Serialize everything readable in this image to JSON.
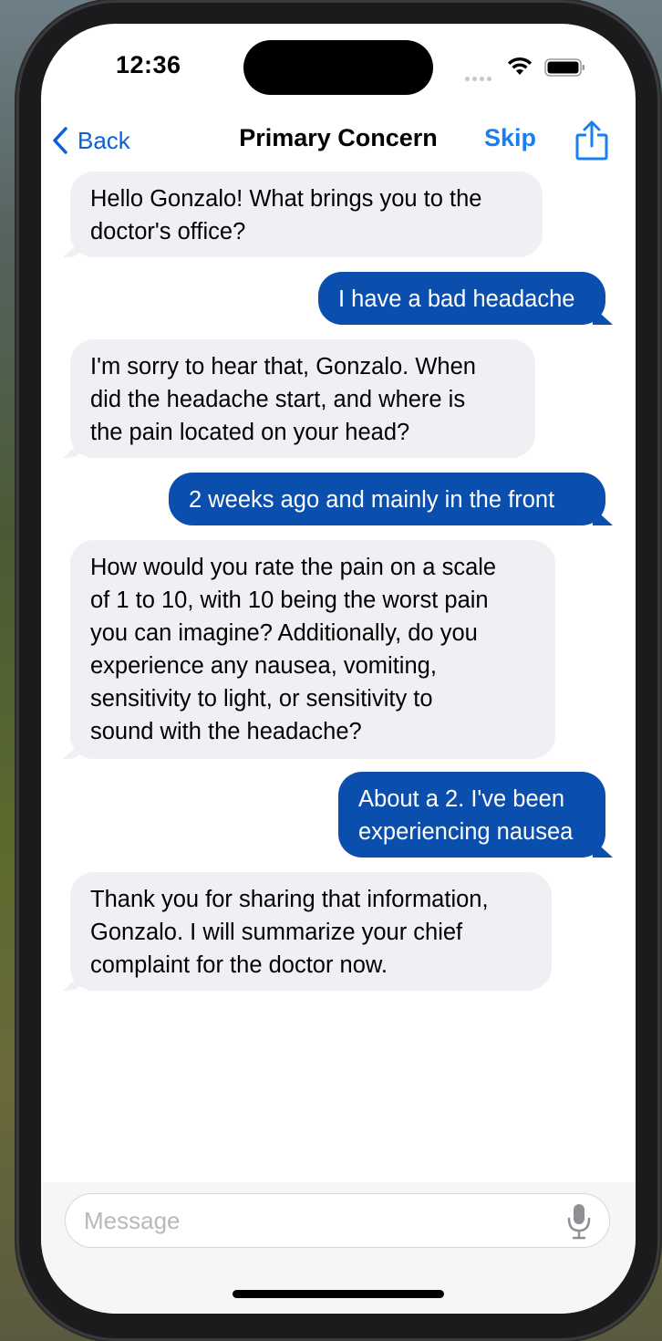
{
  "status_bar": {
    "time": "12:36"
  },
  "nav": {
    "back_label": "Back",
    "title": "Primary Concern",
    "skip_label": "Skip"
  },
  "messages": [
    {
      "sender": "assistant",
      "text": "Hello Gonzalo! What brings you to the\ndoctor's office?"
    },
    {
      "sender": "user",
      "text": "I have a bad headache"
    },
    {
      "sender": "assistant",
      "text": "I'm sorry to hear that, Gonzalo. When\ndid the headache start, and where is\nthe pain located on your head?"
    },
    {
      "sender": "user",
      "text": "2 weeks ago and mainly in the front"
    },
    {
      "sender": "assistant",
      "text": "How would you rate the pain on a scale\nof 1 to 10, with 10 being the worst pain\nyou can imagine? Additionally, do you\nexperience any nausea, vomiting,\nsensitivity to light, or sensitivity to\nsound with the headache?"
    },
    {
      "sender": "user",
      "text": "About a 2. I've been\nexperiencing nausea"
    },
    {
      "sender": "assistant",
      "text": "Thank you for sharing that information,\nGonzalo. I will summarize your chief\ncomplaint for the doctor now."
    }
  ],
  "composer": {
    "placeholder": "Message",
    "value": ""
  },
  "colors": {
    "accent": "#1a7df0",
    "user_bubble": "#0a4fad",
    "assistant_bubble": "#f0f0f4"
  }
}
